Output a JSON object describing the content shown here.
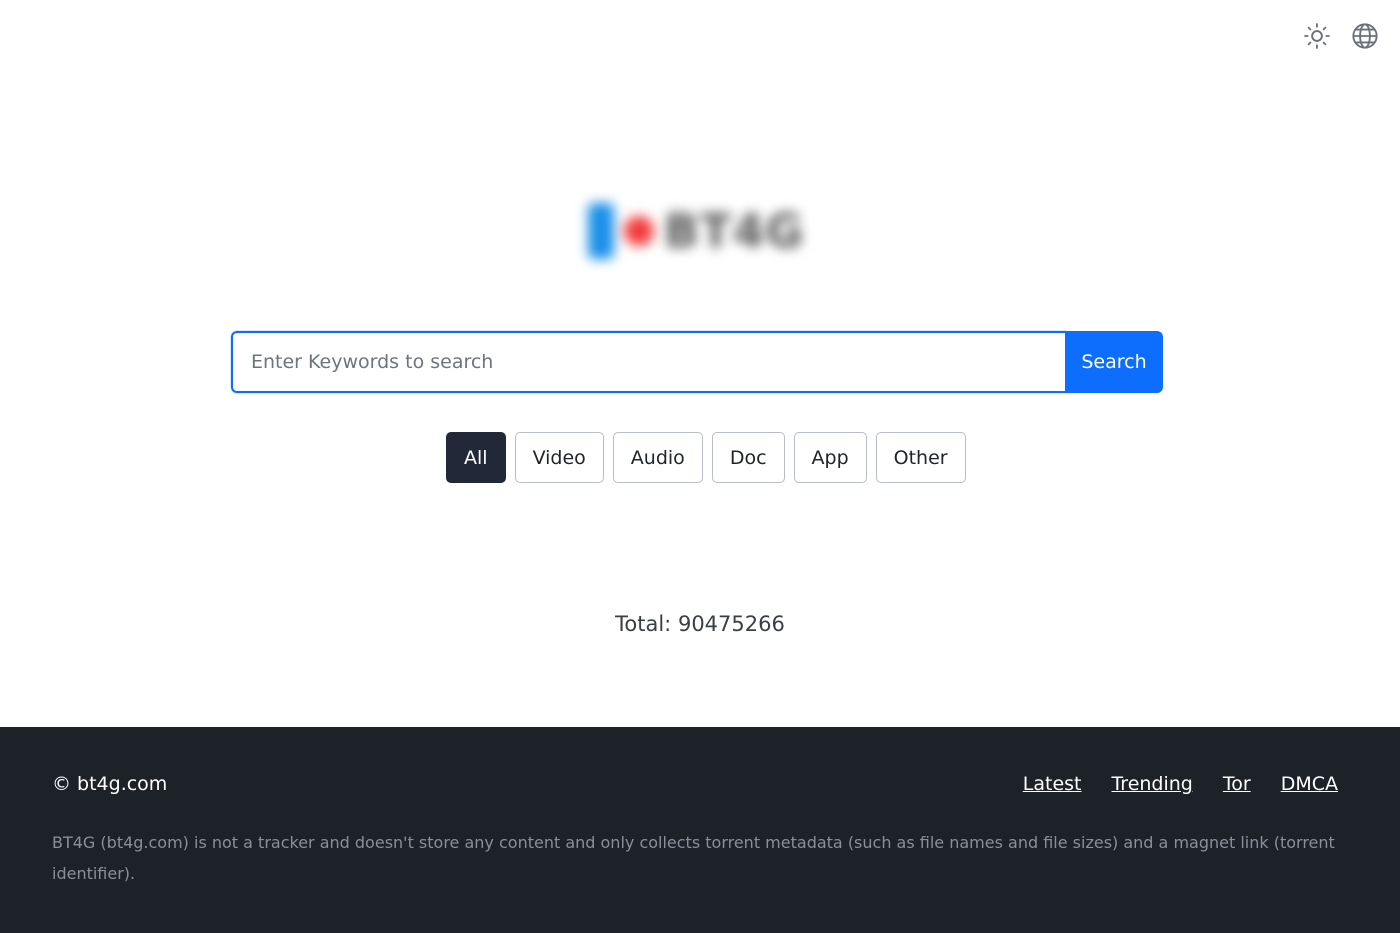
{
  "topbar": {
    "theme_icon": "sun-icon",
    "language_icon": "globe-icon"
  },
  "logo": {
    "text": "BT4G",
    "colors": {
      "bar": "#1a8fe8",
      "dot": "#f23b3b"
    }
  },
  "search": {
    "placeholder": "Enter Keywords to search",
    "value": "",
    "button_label": "Search",
    "accent": "#0d6efd"
  },
  "categories": [
    {
      "label": "All",
      "active": true
    },
    {
      "label": "Video",
      "active": false
    },
    {
      "label": "Audio",
      "active": false
    },
    {
      "label": "Doc",
      "active": false
    },
    {
      "label": "App",
      "active": false
    },
    {
      "label": "Other",
      "active": false
    }
  ],
  "stats": {
    "total_label": "Total:",
    "total_value": "90475266"
  },
  "footer": {
    "copyright": "© bt4g.com",
    "links": [
      "Latest",
      "Trending",
      "Tor",
      "DMCA"
    ],
    "disclaimer": "BT4G (bt4g.com) is not a tracker and doesn't store any content and only collects torrent metadata (such as file names and file sizes) and a magnet link (torrent identifier).",
    "background": "#1d2128"
  }
}
